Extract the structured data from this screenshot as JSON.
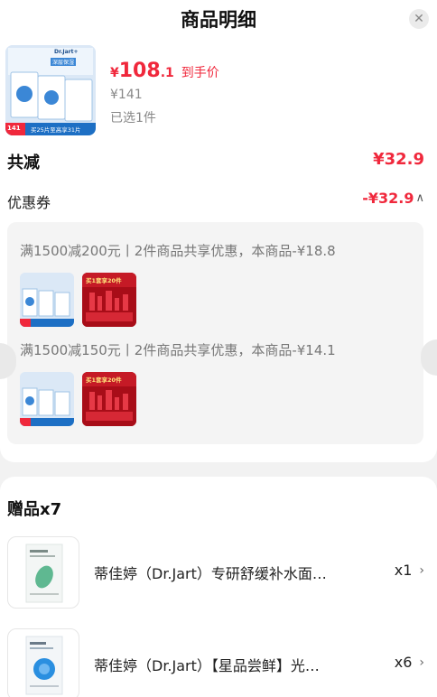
{
  "header": {
    "title": "商品明细"
  },
  "product": {
    "price_symbol": "¥",
    "price_int": "108",
    "price_dec": ".1",
    "price_tag": "到手价",
    "original_price": "¥141",
    "selected": "已选1件",
    "thumb": {
      "brand": "Dr.Jart+",
      "badge": "深层保湿",
      "caption": "买25片至高享31片",
      "price_tag": "141"
    }
  },
  "summary": {
    "total_label": "共减",
    "total_value": "¥32.9"
  },
  "coupon": {
    "label": "优惠券",
    "value": "-¥32.9",
    "promos": [
      {
        "text": "满1500减200元丨2件商品共享优惠，本商品-¥18.8"
      },
      {
        "text": "满1500减150元丨2件商品共享优惠，本商品-¥14.1"
      }
    ],
    "red_product_caption": "买1套享20件"
  },
  "gifts": {
    "title": "赠品x7",
    "items": [
      {
        "name": "蒂佳婷（Dr.Jart）专研舒缓补水面…",
        "qty": "x1"
      },
      {
        "name": "蒂佳婷（Dr.Jart）【星品尝鲜】光…",
        "qty": "x6"
      }
    ]
  },
  "colors": {
    "accent": "#f0283c",
    "thumb_blue": "#d8e7f5",
    "thumb_red": "#b3101c"
  }
}
